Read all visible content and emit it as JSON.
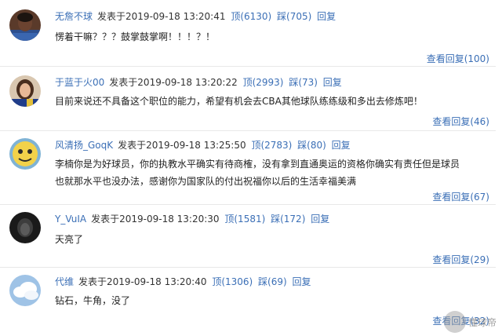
{
  "comments": [
    {
      "username": "无詹不球",
      "posted_label": "发表于",
      "datetime": "2019-09-18 13:20:41",
      "up": "顶(6130)",
      "down": "踩(705)",
      "reply": "回复",
      "lines": [
        "愣着干嘛？？？鼓掌鼓掌啊！！！？！"
      ],
      "view_replies": "查看回复(100)"
    },
    {
      "username": "于蓝于火00",
      "posted_label": "发表于",
      "datetime": "2019-09-18 13:20:22",
      "up": "顶(2993)",
      "down": "踩(73)",
      "reply": "回复",
      "lines": [
        "目前来说还不具备这个职位的能力，希望有机会去CBA其他球队练练级和多出去修炼吧！"
      ],
      "view_replies": "查看回复(46)"
    },
    {
      "username": "风清扬_GoqK",
      "posted_label": "发表于",
      "datetime": "2019-09-18 13:25:50",
      "up": "顶(2783)",
      "down": "踩(80)",
      "reply": "回复",
      "lines": [
        "李楠你是为好球员，你的执教水平确实有待商榷，没有拿到直通奥运的资格你确实有责任但是球员",
        "也就那水平也没办法，感谢你为国家队的付出祝福你以后的生活幸福美满"
      ],
      "view_replies": "查看回复(67)"
    },
    {
      "username": "Y_VuIA",
      "posted_label": "发表于",
      "datetime": "2019-09-18 13:20:30",
      "up": "顶(1581)",
      "down": "踩(172)",
      "reply": "回复",
      "lines": [
        "天亮了"
      ],
      "view_replies": "查看回复(29)"
    },
    {
      "username": "代维",
      "posted_label": "发表于",
      "datetime": "2019-09-18 13:20:40",
      "up": "顶(1306)",
      "down": "踩(69)",
      "reply": "回复",
      "lines": [
        "钻石，牛角，没了"
      ],
      "view_replies": "查看回复(32)"
    }
  ],
  "watermark": "懂球帝",
  "colors": {
    "link": "#3b6fb6",
    "text": "#222222",
    "divider": "#e8e8e8"
  }
}
